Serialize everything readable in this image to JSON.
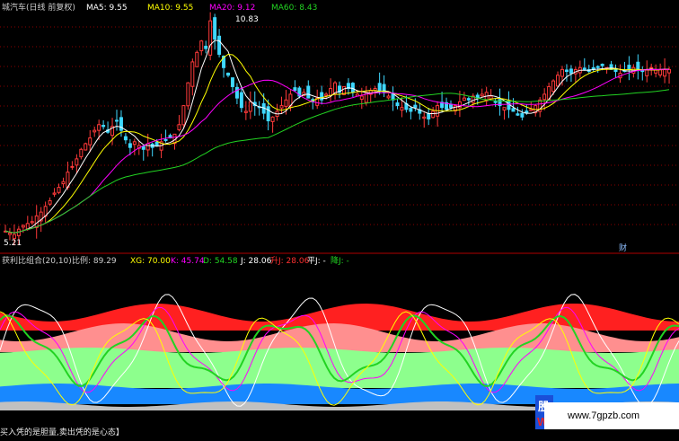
{
  "colors": {
    "background": "#000000",
    "candle_up": "#ff3a3a",
    "candle_down": "#3fd8ff",
    "ma5": "#ffffff",
    "ma10": "#ffff00",
    "ma20": "#ff00ff",
    "ma60": "#22d322",
    "band_red": "#ff2020",
    "band_salmon": "#ff8f8f",
    "band_green": "#8dff8d",
    "band_blue": "#1888ff",
    "band_gray": "#c0c0c0",
    "grid": "#8a0000"
  },
  "main_panel": {
    "title": "城汽车(日线 前复权)",
    "ma_labels": [
      {
        "name": "MA5: 9.55",
        "color": "#ffffff"
      },
      {
        "name": "MA10: 9.55",
        "color": "#ffff00"
      },
      {
        "name": "MA20: 9.12",
        "color": "#ff00ff"
      },
      {
        "name": "MA60: 8.43",
        "color": "#22d322"
      }
    ],
    "high_label": "10.83",
    "low_label": "5.21",
    "marker_label": "财"
  },
  "indicator_panel": {
    "title": "获利比组合(20,10)",
    "ratio": "比例: 89.29",
    "values": [
      {
        "text": "XG: 70.00",
        "color": "#ffff00"
      },
      {
        "text": "K: 45.74",
        "color": "#ff00ff"
      },
      {
        "text": "D: 54.58",
        "color": "#22d322"
      },
      {
        "text": "J: 28.06",
        "color": "#ffffff"
      },
      {
        "text": "升J: 28.06",
        "color": "#ff3030"
      },
      {
        "text": "平J: -",
        "color": "#ffffff"
      },
      {
        "text": "降J: -",
        "color": "#22d322"
      }
    ]
  },
  "watermark": {
    "site": "www.7gpzb.com",
    "logo_top": "股",
    "logo_bottom": "W"
  },
  "caption": "买入凭的是胆量,卖出凭的是心态】",
  "chart_data": {
    "type": "line",
    "title": "城汽车(日线 前复权)",
    "price_high": 10.83,
    "price_low": 5.21,
    "moving_averages": {
      "MA5": 9.55,
      "MA10": 9.55,
      "MA20": 9.12,
      "MA60": 8.43
    },
    "x": [
      0,
      1,
      2,
      3,
      4,
      5,
      6,
      7,
      8,
      9,
      10,
      11,
      12,
      13,
      14,
      15,
      16,
      17,
      18,
      19,
      20,
      21,
      22,
      23,
      24,
      25,
      26,
      27,
      28,
      29,
      30,
      31,
      32,
      33,
      34,
      35,
      36,
      37,
      38,
      39,
      40,
      41,
      42,
      43,
      44,
      45,
      46,
      47,
      48,
      49,
      50,
      51,
      52,
      53,
      54,
      55,
      56,
      57,
      58,
      59,
      60,
      61,
      62,
      63,
      64,
      65,
      66,
      67,
      68,
      69,
      70,
      71,
      72,
      73,
      74,
      75,
      76,
      77,
      78,
      79,
      80,
      81,
      82,
      83,
      84,
      85,
      86,
      87,
      88,
      89,
      90,
      91,
      92,
      93,
      94,
      95,
      96,
      97,
      98,
      99,
      100,
      101,
      102,
      103,
      104,
      105,
      106,
      107,
      108,
      109,
      110,
      111,
      112,
      113,
      114,
      115,
      116,
      117,
      118,
      119,
      120,
      121,
      122,
      123,
      124,
      125,
      126,
      127,
      128,
      129,
      130,
      131,
      132,
      133,
      134,
      135,
      136,
      137,
      138,
      139,
      140,
      141,
      142,
      143,
      144,
      145,
      146,
      147,
      148,
      149
    ],
    "close": [
      5.3,
      5.25,
      5.21,
      5.35,
      5.45,
      5.5,
      5.55,
      5.7,
      5.8,
      5.95,
      6.1,
      6.3,
      6.45,
      6.6,
      6.85,
      7.0,
      7.2,
      7.45,
      7.6,
      7.75,
      7.95,
      8.1,
      8.05,
      7.9,
      8.05,
      8.2,
      7.95,
      7.7,
      7.5,
      7.65,
      7.55,
      7.45,
      7.6,
      7.5,
      7.55,
      7.65,
      7.7,
      7.75,
      7.85,
      8.1,
      8.6,
      9.2,
      9.75,
      10.0,
      10.3,
      10.1,
      10.83,
      10.35,
      9.95,
      9.6,
      9.4,
      9.1,
      8.8,
      8.55,
      8.45,
      8.7,
      8.6,
      8.55,
      8.4,
      8.2,
      8.3,
      8.45,
      8.6,
      8.75,
      8.9,
      9.0,
      8.85,
      8.95,
      8.8,
      8.7,
      8.8,
      8.75,
      8.9,
      9.05,
      9.2,
      8.95,
      9.1,
      9.05,
      8.95,
      8.9,
      8.85,
      8.95,
      9.0,
      9.05,
      9.0,
      8.95,
      8.85,
      8.75,
      8.6,
      8.55,
      8.5,
      8.45,
      8.55,
      8.4,
      8.3,
      8.25,
      8.45,
      8.6,
      8.55,
      8.5,
      8.55,
      8.6,
      8.7,
      8.8,
      8.75,
      8.85,
      8.8,
      8.9,
      8.95,
      8.85,
      8.7,
      8.6,
      8.55,
      8.5,
      8.45,
      8.35,
      8.3,
      8.4,
      8.5,
      8.6,
      8.75,
      8.9,
      9.1,
      9.25,
      9.4,
      9.55,
      9.5,
      9.45,
      9.55,
      9.6,
      9.55,
      9.5,
      9.55,
      9.6,
      9.65,
      9.6,
      9.55,
      9.5,
      9.45,
      9.5,
      9.55,
      9.6,
      9.55,
      9.5,
      9.55,
      9.6,
      9.55,
      9.55,
      9.55,
      9.55
    ]
  }
}
